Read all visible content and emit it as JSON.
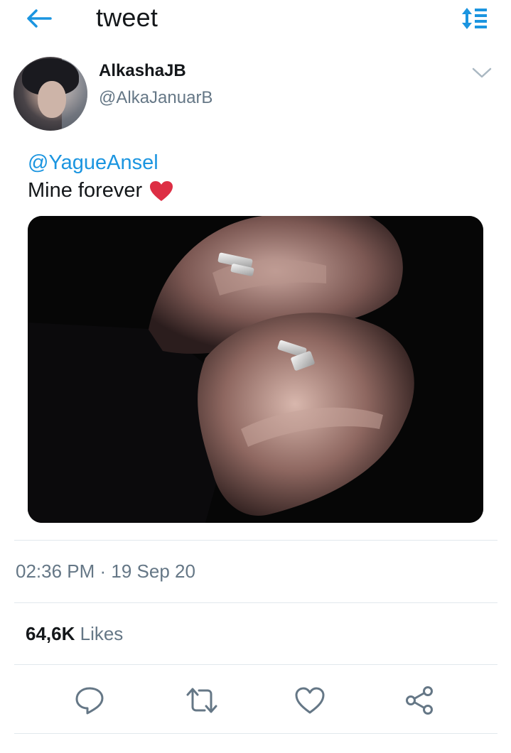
{
  "header": {
    "title": "tweet",
    "back_icon": "arrow-left-icon",
    "sort_icon": "sort-list-icon"
  },
  "user": {
    "display_name": "AlkashaJB",
    "handle": "@AlkaJanuarB",
    "menu_icon": "chevron-down-icon"
  },
  "tweet": {
    "mention": "@YagueAnsel",
    "text": "Mine forever",
    "emoji": "❤️",
    "timestamp": "02:36 PM · 19 Sep 20"
  },
  "stats": {
    "likes_count": "64,6K",
    "likes_label": " Likes"
  },
  "actions": [
    {
      "icon": "reply-icon"
    },
    {
      "icon": "retweet-icon"
    },
    {
      "icon": "like-heart-icon"
    },
    {
      "icon": "share-icon"
    }
  ],
  "colors": {
    "accent": "#1b95e0",
    "text": "#14171a",
    "secondary": "#657786",
    "divider": "#e1e8ed",
    "heart": "#e0245e"
  }
}
